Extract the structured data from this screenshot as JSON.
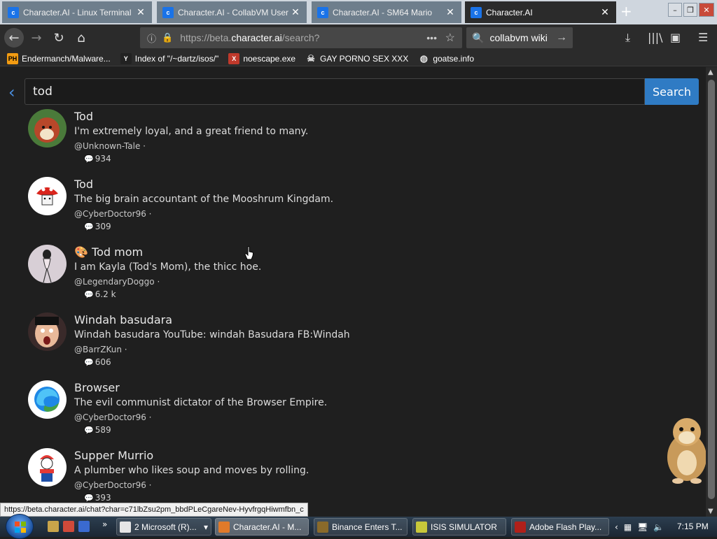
{
  "browser": {
    "tabs": [
      {
        "title": "Character.AI - Linux Terminal",
        "active": false
      },
      {
        "title": "Character.AI - CollabVM User",
        "active": false
      },
      {
        "title": "Character.AI - SM64 Mario",
        "active": false
      },
      {
        "title": "Character.AI",
        "active": true
      }
    ],
    "new_tab": "+",
    "url_prefix": "https://beta.",
    "url_domain": "character.ai",
    "url_suffix": "/search?",
    "search_value": "collabvm wiki",
    "bookmarks": [
      {
        "label": "Endermanch/Malware...",
        "icon": "PH"
      },
      {
        "label": "Index of \"/~dartz/isos/\"",
        "icon": "Y"
      },
      {
        "label": "noescape.exe",
        "icon": "X"
      },
      {
        "label": "GAY PORNO SEX XXX",
        "icon": "skull"
      },
      {
        "label": "goatse.info",
        "icon": "globe"
      }
    ]
  },
  "page": {
    "search_query": "tod",
    "search_button": "Search",
    "results": [
      {
        "name": "Tod",
        "prefix": "",
        "description": "I'm extremely loyal, and a great friend to many.",
        "author": "@Unknown-Tale ·",
        "count": "934"
      },
      {
        "name": "Tod",
        "prefix": "",
        "description": "The big brain accountant of the Mooshrum Kingdam.",
        "author": "@CyberDoctor96 ·",
        "count": "309"
      },
      {
        "name": "Tod mom",
        "prefix": "🎨",
        "description": "I am Kayla (Tod's Mom), the thicc hoe.",
        "author": "@LegendaryDoggo ·",
        "count": "6.2 k"
      },
      {
        "name": "Windah basudara",
        "prefix": "",
        "description": "Windah basudara YouTube: windah Basudara FB:Windah",
        "author": "@BarrZKun ·",
        "count": "606"
      },
      {
        "name": "Browser",
        "prefix": "",
        "description": "The evil communist dictator of the Browser Empire.",
        "author": "@CyberDoctor96 ·",
        "count": "589"
      },
      {
        "name": "Supper Murrio",
        "prefix": "",
        "description": "A plumber who likes soup and moves by rolling.",
        "author": "@CyberDoctor96 ·",
        "count": "393"
      }
    ],
    "status_url": "https://beta.character.ai/chat?char=c71lbZsu2pm_bbdPLeCgareNev-HyvfrgqHiwmfbn_c"
  },
  "taskbar": {
    "buttons": [
      {
        "label": "2 Microsoft (R)...",
        "active": false
      },
      {
        "label": "Character.AI - M...",
        "active": true
      },
      {
        "label": "Binance Enters T...",
        "active": false
      },
      {
        "label": "ISIS SIMULATOR",
        "active": false
      },
      {
        "label": "Adobe Flash Play...",
        "active": false
      }
    ],
    "clock": "7:15 PM"
  },
  "colors": {
    "accent": "#2f7bc4",
    "page_bg": "#1f1f1f",
    "chrome_bg": "#2b2b2b"
  }
}
